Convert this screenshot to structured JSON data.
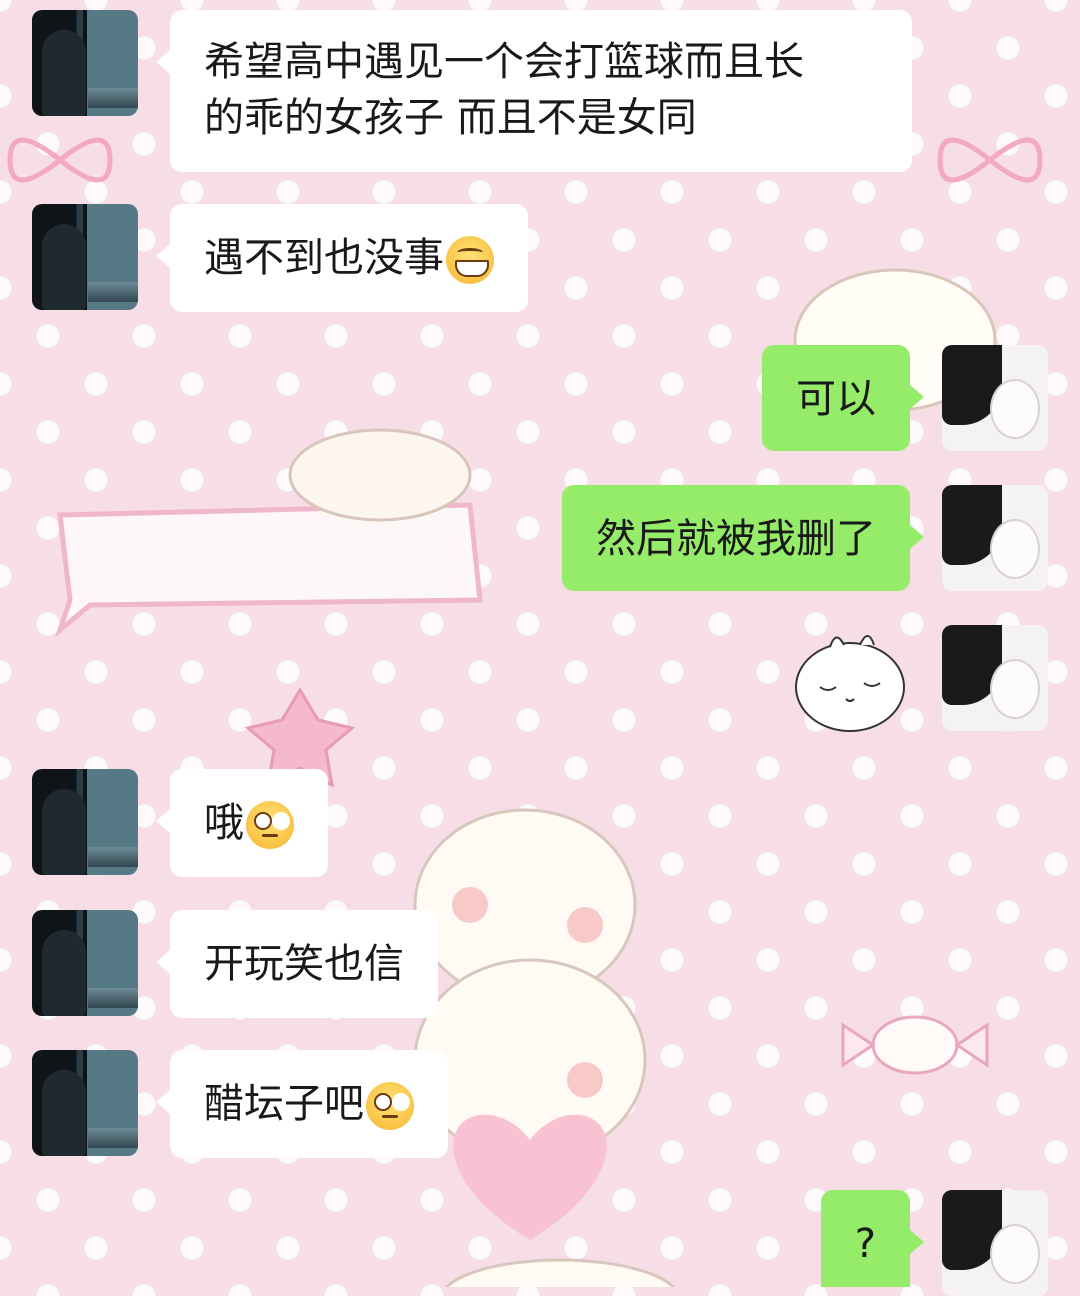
{
  "colors": {
    "background": "#f7dde6",
    "incoming_bubble": "#ffffff",
    "outgoing_bubble": "#95ec69",
    "text": "#191919"
  },
  "messages": [
    {
      "side": "left",
      "lines": [
        "希望高中遇见一个会打篮球而且长",
        "的乖的女孩子 而且不是女同"
      ]
    },
    {
      "side": "left",
      "text": "遇不到也没事",
      "emoji": "grinning-face"
    },
    {
      "side": "right",
      "text": "可以"
    },
    {
      "side": "right",
      "text": "然后就被我删了"
    },
    {
      "side": "right",
      "sticker": "sleepy-bunny-sticker"
    },
    {
      "side": "left",
      "text": "哦",
      "emoji": "eye-roll-face"
    },
    {
      "side": "left",
      "text": "开玩笑也信"
    },
    {
      "side": "left",
      "text": "醋坛子吧",
      "emoji": "eye-roll-face"
    },
    {
      "side": "right",
      "text": "?"
    }
  ]
}
